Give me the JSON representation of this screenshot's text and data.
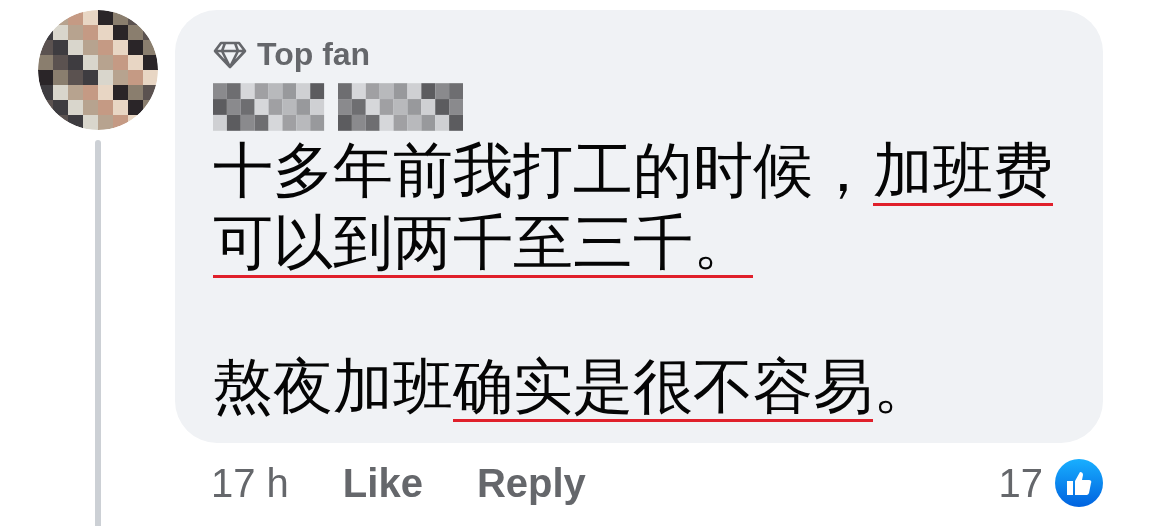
{
  "comment": {
    "badge": "Top fan",
    "paragraphs": [
      [
        {
          "text": "十多年前我打工的时候，",
          "underlined": false
        },
        {
          "text": "加班费",
          "underlined": true
        },
        {
          "text": "可以到两千至三千。",
          "underlined": true
        }
      ],
      [
        {
          "text": "熬夜加班",
          "underlined": false
        },
        {
          "text": "确实是很不容易",
          "underlined": true
        },
        {
          "text": "。",
          "underlined": false
        }
      ]
    ],
    "time": "17 h",
    "actions": [
      "Like",
      "Reply"
    ],
    "reaction_count": "17"
  }
}
